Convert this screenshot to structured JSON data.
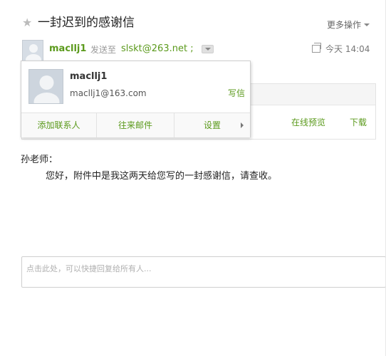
{
  "header": {
    "subject": "一封迟到的感谢信",
    "more_actions": "更多操作"
  },
  "sender": {
    "name": "macllj1",
    "sent_to_label": "发送至",
    "recipient": "slskt@263.net ;",
    "date": "今天 14:04"
  },
  "popup": {
    "name": "macllj1",
    "email": "macllj1@163.com",
    "write_label": "写信",
    "footer": {
      "add_contact": "添加联系人",
      "mail_history": "往来邮件",
      "settings": "设置"
    }
  },
  "attachment": {
    "preview_label": "在线预览",
    "download_label": "下载"
  },
  "body": {
    "greeting": "孙老师：",
    "text": "您好，附件中是我这两天给您写的一封感谢信，请查收。"
  },
  "reply": {
    "placeholder": "点击此处，可以快捷回复给所有人..."
  },
  "colors": {
    "accent": "#5b9a1c",
    "text": "#222222",
    "muted": "#999999"
  }
}
